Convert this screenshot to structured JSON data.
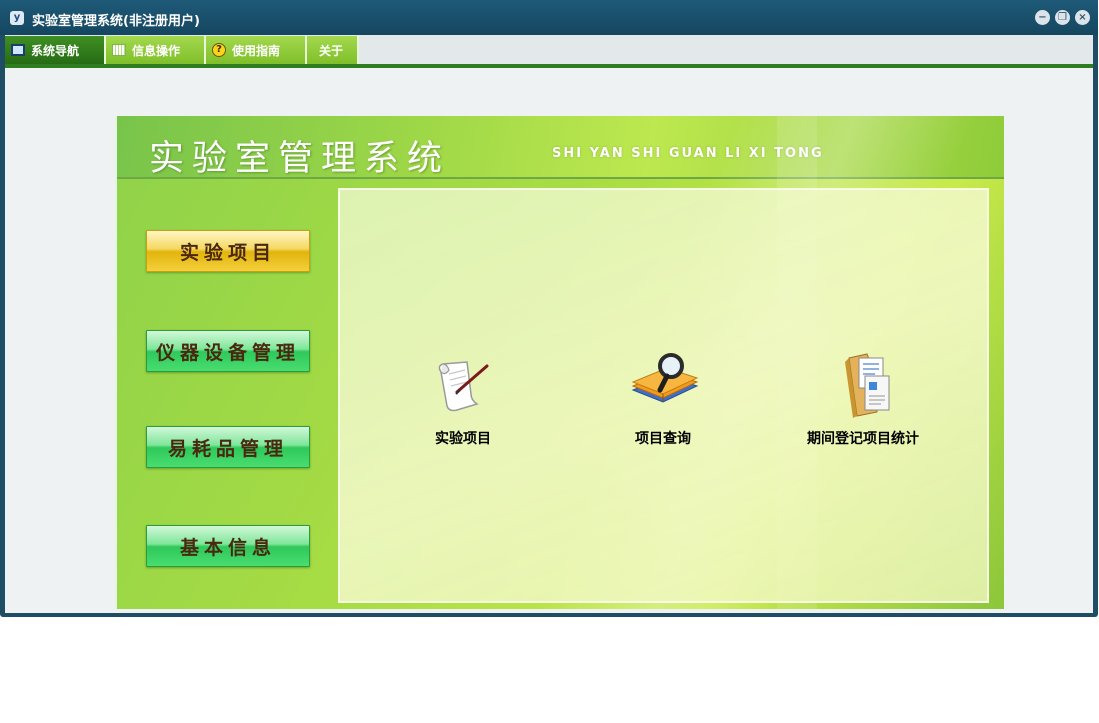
{
  "window": {
    "title": "实验室管理系统(非注册用户)",
    "app_icon_glyph": "y",
    "controls": {
      "minimize": "−",
      "restore": "❐",
      "close": "×"
    }
  },
  "menu": {
    "tabs": [
      {
        "label": "系统导航",
        "icon": "monitor-icon",
        "active": true
      },
      {
        "label": "信息操作",
        "icon": "grid-icon",
        "active": false
      },
      {
        "label": "使用指南",
        "icon": "help-icon",
        "active": false
      },
      {
        "label": "关于",
        "icon": "",
        "active": false
      }
    ],
    "help_glyph": "?"
  },
  "banner": {
    "title": "实验室管理系统",
    "subtitle": "SHI YAN SHI GUAN LI XI TONG"
  },
  "nav": {
    "buttons": [
      {
        "label": "实验项目",
        "style": "gold"
      },
      {
        "label": "仪器设备管理",
        "style": "green"
      },
      {
        "label": "易耗品管理",
        "style": "green"
      },
      {
        "label": "基本信息",
        "style": "green"
      }
    ]
  },
  "desktop": {
    "items": [
      {
        "label": "实验项目",
        "icon": "scroll-quill-icon"
      },
      {
        "label": "项目查询",
        "icon": "books-magnifier-icon"
      },
      {
        "label": "期间登记项目统计",
        "icon": "folder-documents-icon"
      }
    ]
  },
  "colors": {
    "titlebar": "#1e5a78",
    "menu_active": "#3e8f24",
    "menu_normal": "#a4d84e",
    "accent_line": "#2e7d1e",
    "banner_green": "#a9dd43"
  }
}
